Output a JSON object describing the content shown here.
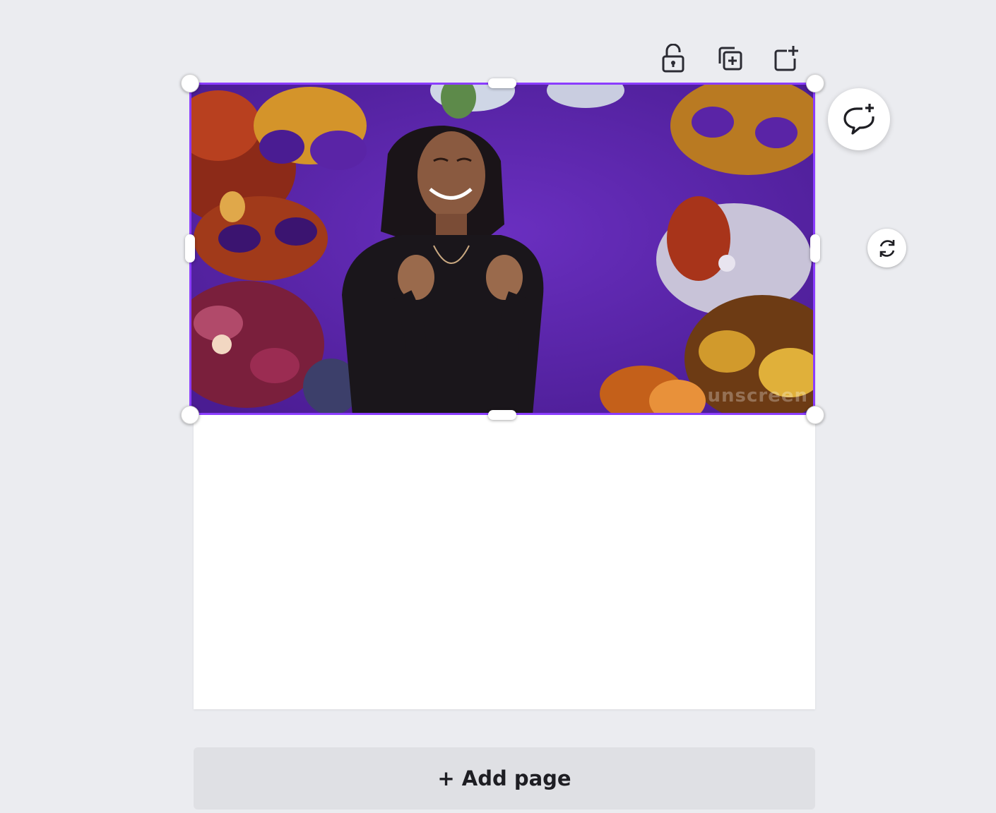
{
  "toolbar": {
    "icons": [
      "unlock-icon",
      "duplicate-page-icon",
      "add-page-icon"
    ]
  },
  "canvas": {
    "media": {
      "kind": "animated image",
      "watermark_text": "unscreen"
    }
  },
  "floating": {
    "comment_icon": "add-comment-icon",
    "rotate_icon": "rotate-icon"
  },
  "footer": {
    "add_page_label": "+ Add page"
  },
  "colors": {
    "selection": "#8b3dff",
    "background": "#ebecf0",
    "media_bg": "#5a24a6"
  }
}
